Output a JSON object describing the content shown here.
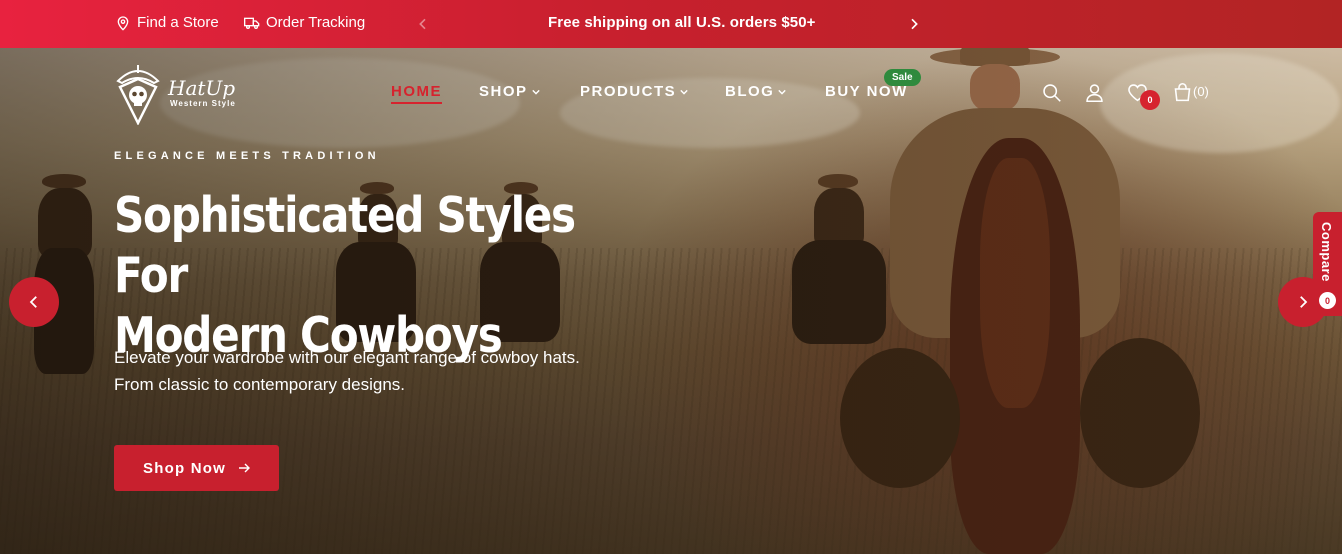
{
  "topbar": {
    "find_store": "Find a Store",
    "order_tracking": "Order Tracking",
    "promo": "Free shipping on all U.S. orders $50+"
  },
  "logo": {
    "name": "HatUp",
    "tagline": "Western Style"
  },
  "nav": {
    "items": [
      {
        "label": "HOME",
        "active": true
      },
      {
        "label": "SHOP",
        "dropdown": true
      },
      {
        "label": "PRODUCTS",
        "dropdown": true
      },
      {
        "label": "BLOG",
        "dropdown": true
      },
      {
        "label": "BUY NOW"
      }
    ],
    "sale_badge": "Sale"
  },
  "header_icons": {
    "wishlist_count": "0",
    "cart_count": "(0)"
  },
  "hero": {
    "eyebrow": "ELEGANCE MEETS TRADITION",
    "headline_line1": "Sophisticated Styles For",
    "headline_line2": "Modern Cowboys",
    "subtext_line1": "Elevate your wardrobe with our elegant range of cowboy hats.",
    "subtext_line2": "From classic to contemporary designs.",
    "cta_label": "Shop Now"
  },
  "compare": {
    "label": "Compare",
    "count": "0"
  },
  "colors": {
    "brand_red": "#c8202e",
    "sale_green": "#2f8a3d"
  }
}
